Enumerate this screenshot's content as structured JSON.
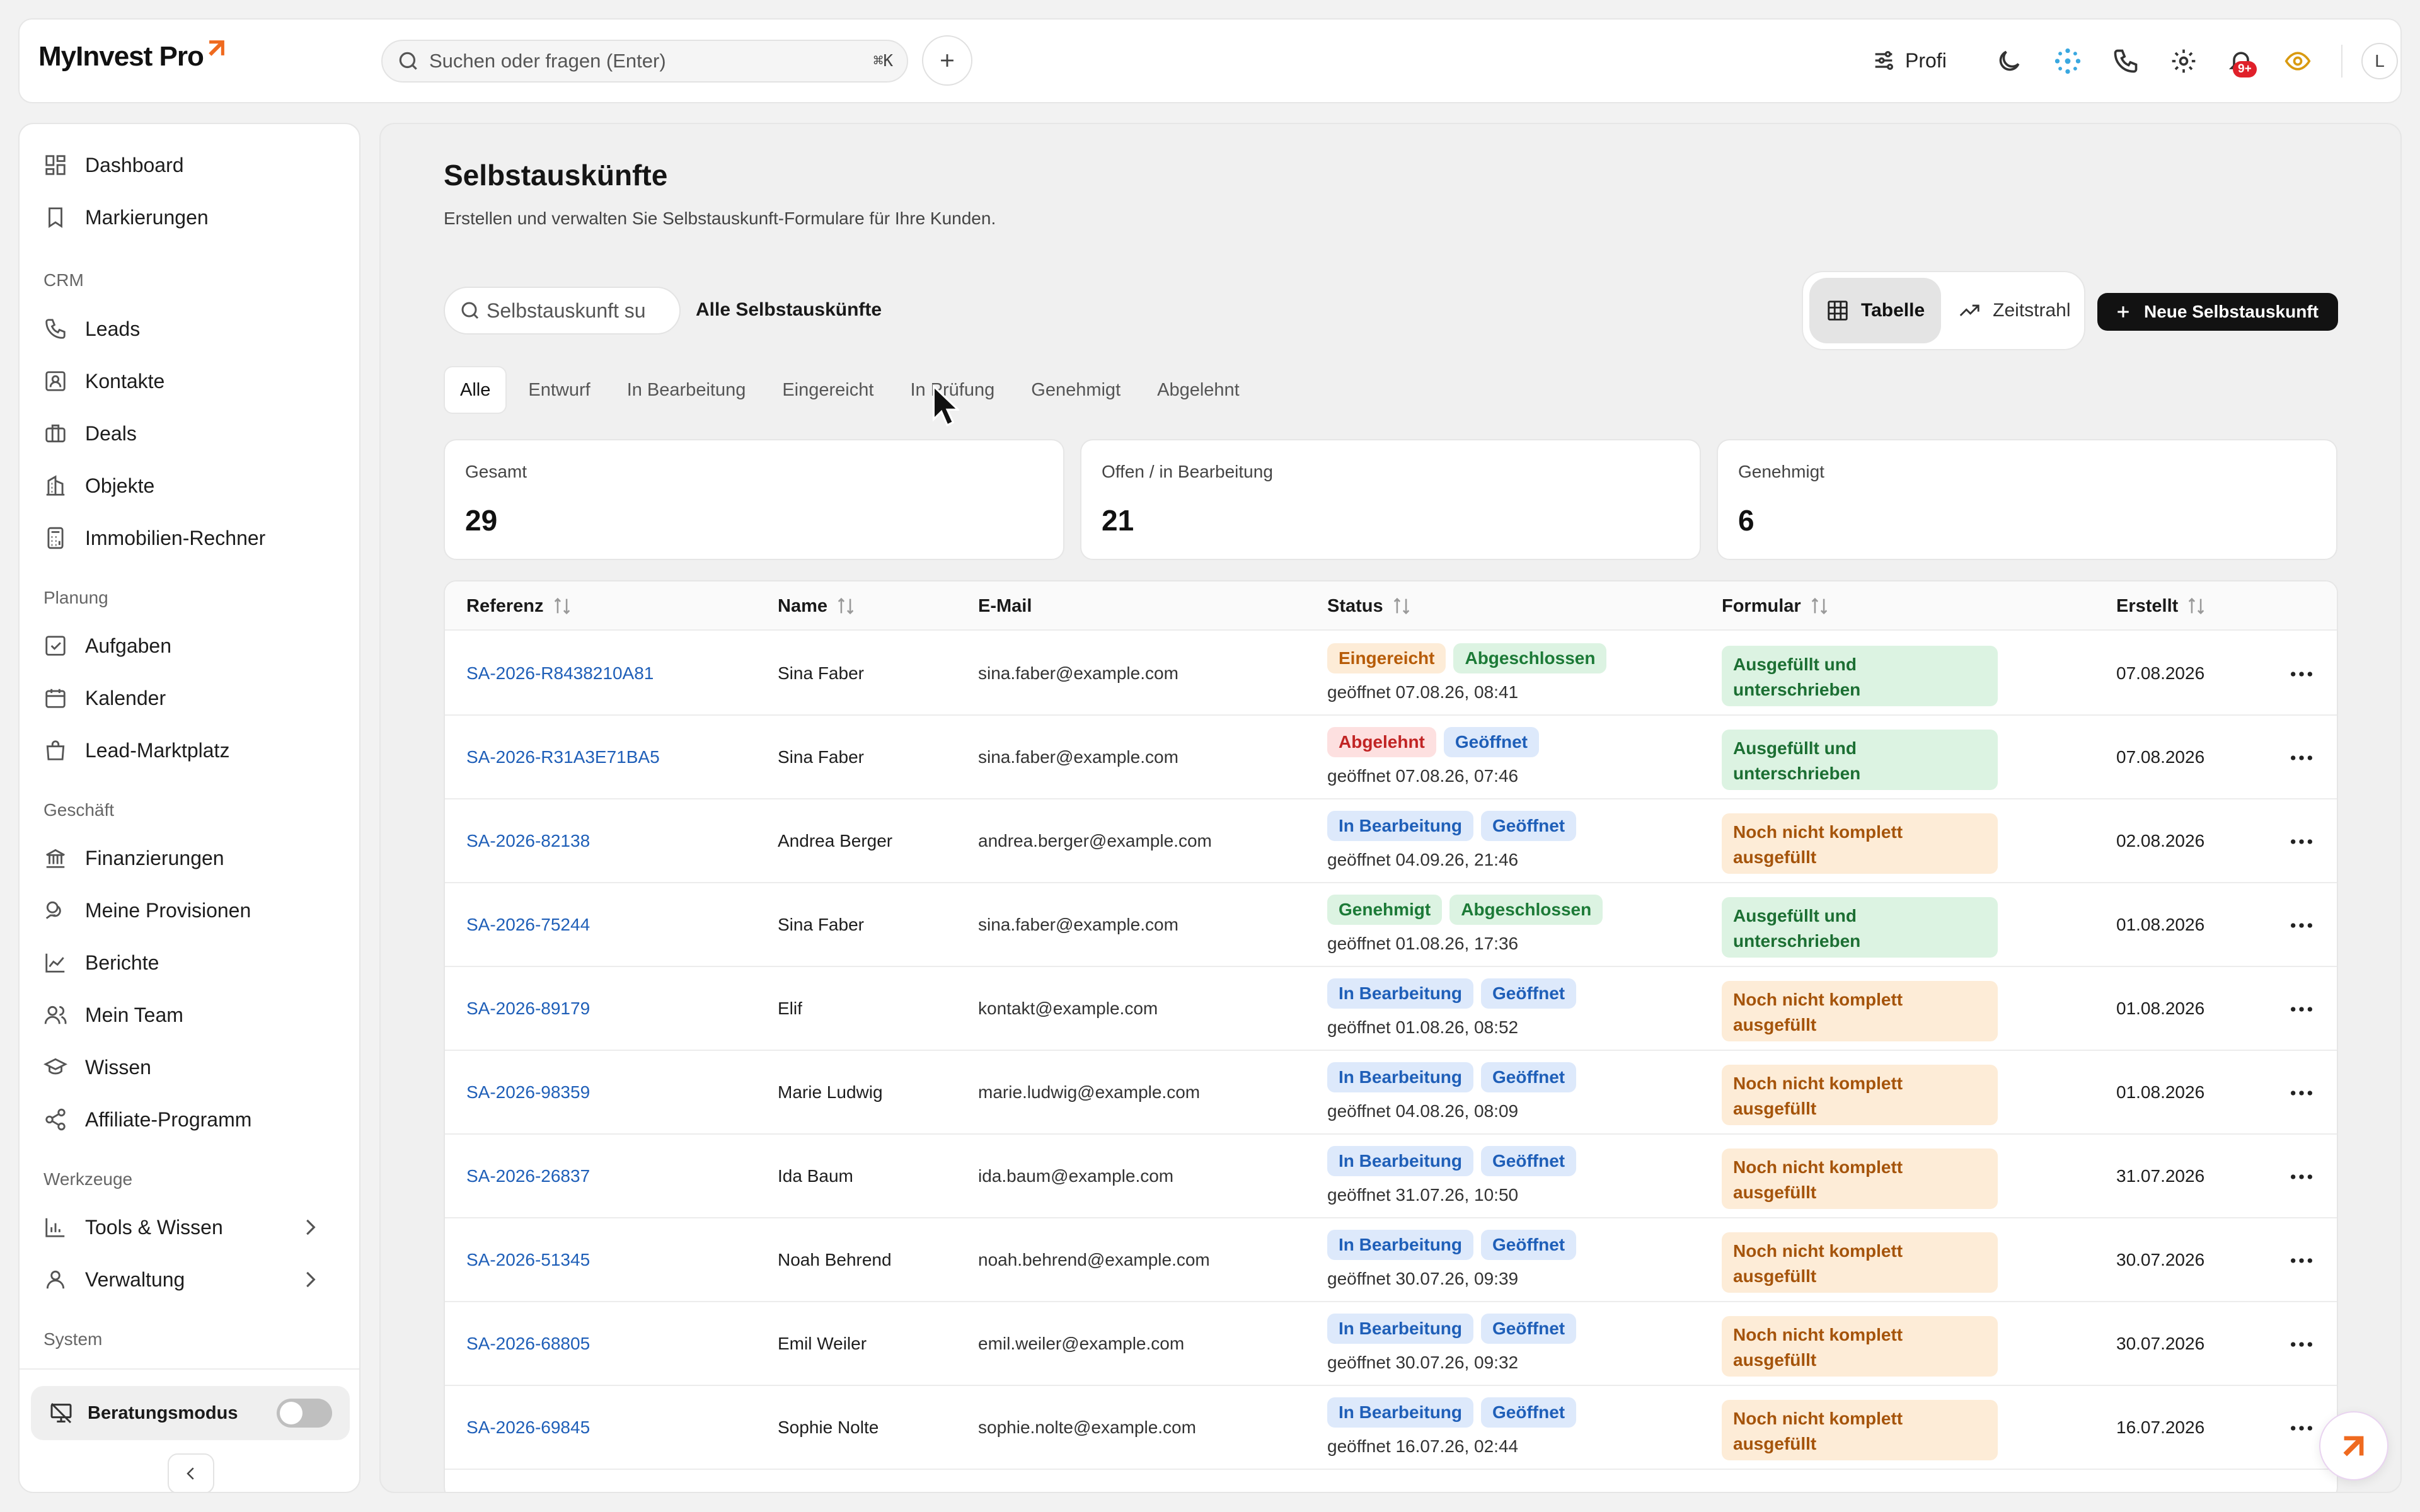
{
  "brand": {
    "name": "MyInvest Pro",
    "accent": "#ef6a1f"
  },
  "topbar": {
    "search_placeholder": "Suchen oder fragen (Enter)",
    "shortcut": "⌘K",
    "mode_label": "Profi",
    "notifications_badge": "9+",
    "avatar_initial": "L"
  },
  "sidebar": {
    "top_items": [
      {
        "label": "Dashboard",
        "icon": "dashboard-icon"
      },
      {
        "label": "Markierungen",
        "icon": "bookmark-icon"
      }
    ],
    "sections": {
      "crm": "CRM",
      "planung": "Planung",
      "geschaeft": "Geschäft",
      "werkzeuge": "Werkzeuge",
      "system": "System"
    },
    "crm_items": [
      {
        "label": "Leads",
        "icon": "phone-icon"
      },
      {
        "label": "Kontakte",
        "icon": "contact-icon"
      },
      {
        "label": "Deals",
        "icon": "briefcase-icon"
      },
      {
        "label": "Objekte",
        "icon": "building-icon"
      },
      {
        "label": "Immobilien-Rechner",
        "icon": "calculator-icon"
      }
    ],
    "planung_items": [
      {
        "label": "Aufgaben",
        "icon": "checkbox-icon"
      },
      {
        "label": "Kalender",
        "icon": "calendar-icon"
      },
      {
        "label": "Lead-Marktplatz",
        "icon": "shopping-bag-icon"
      }
    ],
    "geschaeft_items": [
      {
        "label": "Finanzierungen",
        "icon": "bank-icon"
      },
      {
        "label": "Meine Provisionen",
        "icon": "coins-icon"
      },
      {
        "label": "Berichte",
        "icon": "chart-line-icon"
      },
      {
        "label": "Mein Team",
        "icon": "team-icon"
      },
      {
        "label": "Wissen",
        "icon": "graduation-cap-icon"
      },
      {
        "label": "Affiliate-Programm",
        "icon": "share-icon"
      }
    ],
    "werkzeuge_items": [
      {
        "label": "Tools & Wissen",
        "icon": "bar-chart-icon"
      },
      {
        "label": "Verwaltung",
        "icon": "user-icon"
      }
    ],
    "consult_mode_label": "Beratungsmodus",
    "consult_mode_on": false
  },
  "main": {
    "title": "Selbstauskünfte",
    "subtitle": "Erstellen und verwalten Sie Selbstauskunft-Formulare für Ihre Kunden.",
    "search_placeholder": "Selbstauskunft su",
    "all_label": "Alle Selbstauskünfte",
    "view_table": "Tabelle",
    "view_timeline": "Zeitstrahl",
    "new_button": "Neue Selbstauskunft",
    "tabs": [
      "Alle",
      "Entwurf",
      "In Bearbeitung",
      "Eingereicht",
      "In Prüfung",
      "Genehmigt",
      "Abgelehnt"
    ],
    "active_tab": "Alle",
    "stats": [
      {
        "label": "Gesamt",
        "value": "29"
      },
      {
        "label": "Offen / in Bearbeitung",
        "value": "21"
      },
      {
        "label": "Genehmigt",
        "value": "6"
      }
    ],
    "columns": {
      "ref": "Referenz",
      "name": "Name",
      "email": "E-Mail",
      "status": "Status",
      "form": "Formular",
      "created": "Erstellt"
    },
    "rows": [
      {
        "ref": "SA-2026-R8438210A81",
        "name": "Sina Faber",
        "email": "sina.faber@example.com",
        "status": "Eingereicht",
        "status_color": "orange",
        "state": "Abgeschlossen",
        "state_color": "green",
        "opened": "geöffnet 07.08.26, 08:41",
        "form": "Ausgefüllt und unterschrieben",
        "form_color": "green",
        "created": "07.08.2026"
      },
      {
        "ref": "SA-2026-R31A3E71BA5",
        "name": "Sina Faber",
        "email": "sina.faber@example.com",
        "status": "Abgelehnt",
        "status_color": "red",
        "state": "Geöffnet",
        "state_color": "blue",
        "opened": "geöffnet 07.08.26, 07:46",
        "form": "Ausgefüllt und unterschrieben",
        "form_color": "green",
        "created": "07.08.2026"
      },
      {
        "ref": "SA-2026-82138",
        "name": "Andrea Berger",
        "email": "andrea.berger@example.com",
        "status": "In Bearbeitung",
        "status_color": "blue",
        "state": "Geöffnet",
        "state_color": "blue",
        "opened": "geöffnet 04.09.26, 21:46",
        "form": "Noch nicht komplett ausgefüllt",
        "form_color": "orange",
        "created": "02.08.2026"
      },
      {
        "ref": "SA-2026-75244",
        "name": "Sina Faber",
        "email": "sina.faber@example.com",
        "status": "Genehmigt",
        "status_color": "green",
        "state": "Abgeschlossen",
        "state_color": "green",
        "opened": "geöffnet 01.08.26, 17:36",
        "form": "Ausgefüllt und unterschrieben",
        "form_color": "green",
        "created": "01.08.2026"
      },
      {
        "ref": "SA-2026-89179",
        "name": "Elif",
        "email": "kontakt@example.com",
        "status": "In Bearbeitung",
        "status_color": "blue",
        "state": "Geöffnet",
        "state_color": "blue",
        "opened": "geöffnet 01.08.26, 08:52",
        "form": "Noch nicht komplett ausgefüllt",
        "form_color": "orange",
        "created": "01.08.2026"
      },
      {
        "ref": "SA-2026-98359",
        "name": "Marie Ludwig",
        "email": "marie.ludwig@example.com",
        "status": "In Bearbeitung",
        "status_color": "blue",
        "state": "Geöffnet",
        "state_color": "blue",
        "opened": "geöffnet 04.08.26, 08:09",
        "form": "Noch nicht komplett ausgefüllt",
        "form_color": "orange",
        "created": "01.08.2026"
      },
      {
        "ref": "SA-2026-26837",
        "name": "Ida Baum",
        "email": "ida.baum@example.com",
        "status": "In Bearbeitung",
        "status_color": "blue",
        "state": "Geöffnet",
        "state_color": "blue",
        "opened": "geöffnet 31.07.26, 10:50",
        "form": "Noch nicht komplett ausgefüllt",
        "form_color": "orange",
        "created": "31.07.2026"
      },
      {
        "ref": "SA-2026-51345",
        "name": "Noah Behrend",
        "email": "noah.behrend@example.com",
        "status": "In Bearbeitung",
        "status_color": "blue",
        "state": "Geöffnet",
        "state_color": "blue",
        "opened": "geöffnet 30.07.26, 09:39",
        "form": "Noch nicht komplett ausgefüllt",
        "form_color": "orange",
        "created": "30.07.2026"
      },
      {
        "ref": "SA-2026-68805",
        "name": "Emil Weiler",
        "email": "emil.weiler@example.com",
        "status": "In Bearbeitung",
        "status_color": "blue",
        "state": "Geöffnet",
        "state_color": "blue",
        "opened": "geöffnet 30.07.26, 09:32",
        "form": "Noch nicht komplett ausgefüllt",
        "form_color": "orange",
        "created": "30.07.2026"
      },
      {
        "ref": "SA-2026-69845",
        "name": "Sophie Nolte",
        "email": "sophie.nolte@example.com",
        "status": "In Bearbeitung",
        "status_color": "blue",
        "state": "Geöffnet",
        "state_color": "blue",
        "opened": "geöffnet 16.07.26, 02:44",
        "form": "Noch nicht komplett ausgefüllt",
        "form_color": "orange",
        "created": "16.07.2026"
      }
    ]
  }
}
